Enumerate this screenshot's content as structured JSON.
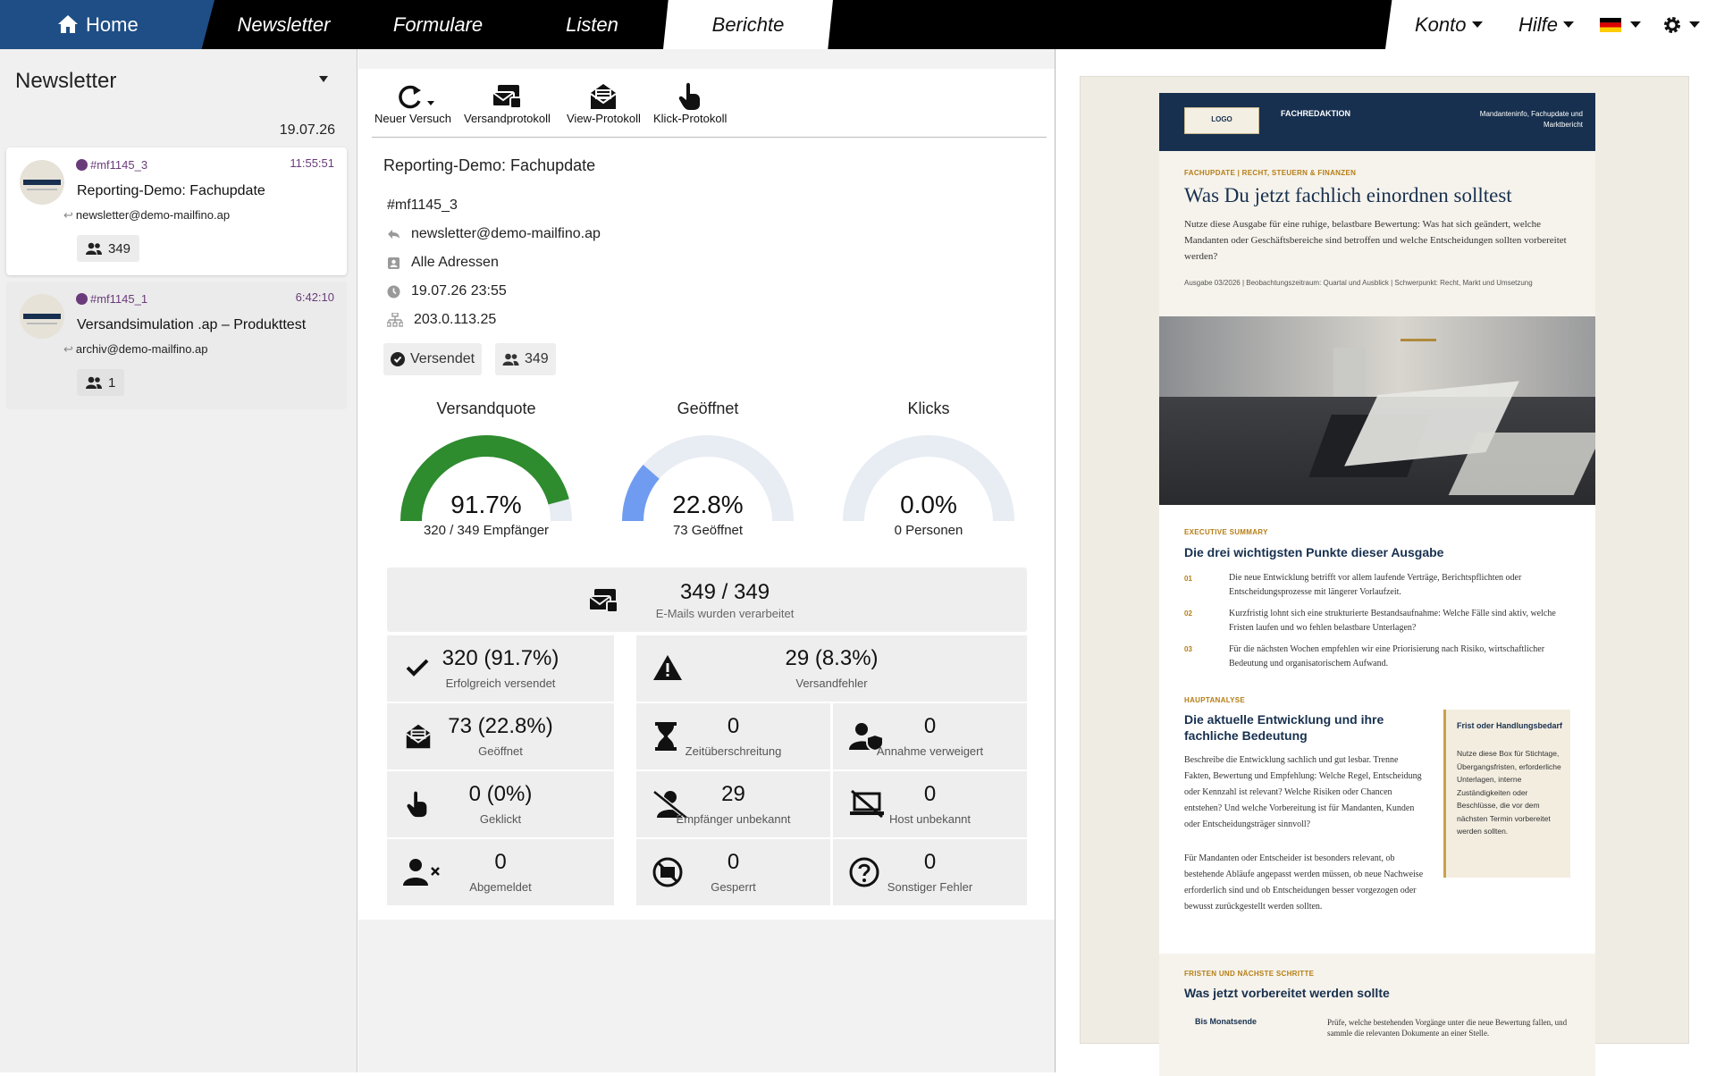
{
  "nav": {
    "home": "Home",
    "tabs": [
      "Newsletter",
      "Formulare",
      "Listen",
      "Berichte"
    ],
    "active_tab": "Berichte",
    "konto": "Konto",
    "hilfe": "Hilfe"
  },
  "sidebar": {
    "title": "Newsletter",
    "date": "19.07.26",
    "items": [
      {
        "id": "#mf1145_3",
        "time": "11:55:51",
        "name": "Reporting-Demo: Fachupdate",
        "from": "newsletter@demo-mailfino.ap",
        "count": "349"
      },
      {
        "id": "#mf1145_1",
        "time": "6:42:10",
        "name": "Versandsimulation .ap – Produkttest",
        "from": "archiv@demo-mailfino.ap",
        "count": "1"
      }
    ]
  },
  "toolbar": {
    "neuer_versuch": "Neuer Versuch",
    "versandprotokoll": "Versandprotokoll",
    "view_protokoll": "View-Protokoll",
    "klick_protokoll": "Klick-Protokoll"
  },
  "report": {
    "title": "Reporting-Demo: Fachupdate",
    "id": "#mf1145_3",
    "sender": "newsletter@demo-mailfino.ap",
    "recipients": "Alle Adressen",
    "datetime": "19.07.26 23:55",
    "ip": "203.0.113.25",
    "status": "Versendet",
    "count": "349"
  },
  "gauges": [
    {
      "label": "Versandquote",
      "value": "91.7%",
      "fraction": 0.917,
      "sub": "320 / 349 Empfänger",
      "color": "#2e8b2e"
    },
    {
      "label": "Geöffnet",
      "value": "22.8%",
      "fraction": 0.228,
      "sub": "73 Geöffnet",
      "color": "#6f9cf0"
    },
    {
      "label": "Klicks",
      "value": "0.0%",
      "fraction": 0.0,
      "sub": "0 Personen",
      "color": "#6f9cf0"
    }
  ],
  "stats": {
    "processed": {
      "value": "349 / 349",
      "label": "E-Mails wurden verarbeitet"
    },
    "success": {
      "value": "320 (91.7%)",
      "label": "Erfolgreich versendet"
    },
    "errors": {
      "value": "29 (8.3%)",
      "label": "Versandfehler"
    },
    "opened": {
      "value": "73 (22.8%)",
      "label": "Geöffnet"
    },
    "timeout": {
      "value": "0",
      "label": "Zeitüberschreitung"
    },
    "rejected": {
      "value": "0",
      "label": "Annahme verweigert"
    },
    "clicked": {
      "value": "0 (0%)",
      "label": "Geklickt"
    },
    "unknown_recipient": {
      "value": "29",
      "label": "Empfänger unbekannt"
    },
    "unknown_host": {
      "value": "0",
      "label": "Host unbekannt"
    },
    "unsubscribed": {
      "value": "0",
      "label": "Abgemeldet"
    },
    "blocked": {
      "value": "0",
      "label": "Gesperrt"
    },
    "other": {
      "value": "0",
      "label": "Sonstiger Fehler"
    }
  },
  "preview": {
    "logo": "LOGO",
    "brand": "FACHREDAKTION",
    "mandant": "Mandanteninfo, Fachupdate und Marktbericht",
    "kicker1": "FACHUPDATE | RECHT, STEUERN & FINANZEN",
    "headline": "Was Du jetzt fachlich einordnen solltest",
    "intro": "Nutze diese Ausgabe für eine ruhige, belastbare Bewertung: Was hat sich geändert, welche Mandanten oder Geschäftsbereiche sind betroffen und welche Entscheidungen sollten vorbereitet werden?",
    "meta": "Ausgabe 03/2026 | Beobachtungszeitraum: Quartal und Ausblick | Schwerpunkt: Recht, Markt und Umsetzung",
    "kicker2": "EXECUTIVE SUMMARY",
    "h2a": "Die drei wichtigsten Punkte dieser Ausgabe",
    "points": [
      {
        "n": "01",
        "t": "Die neue Entwicklung betrifft vor allem laufende Verträge, Berichtspflichten oder Entscheidungsprozesse mit längerer Vorlaufzeit."
      },
      {
        "n": "02",
        "t": "Kurzfristig lohnt sich eine strukturierte Bestandsaufnahme: Welche Fälle sind aktiv, welche Fristen laufen und wo fehlen belastbare Unterlagen?"
      },
      {
        "n": "03",
        "t": "Für die nächsten Wochen empfehlen wir eine Priorisierung nach Risiko, wirtschaftlicher Bedeutung und organisatorischem Aufwand."
      }
    ],
    "kicker3": "HAUPTANALYSE",
    "h2b": "Die aktuelle Entwicklung und ihre fachliche Bedeutung",
    "body1": "Beschreibe die Entwicklung sachlich und gut lesbar. Trenne Fakten, Bewertung und Empfehlung: Welche Regel, Entscheidung oder Kennzahl ist relevant? Welche Risiken oder Chancen entstehen? Und welche Vorbereitung ist für Mandanten, Kunden oder Entscheidungsträger sinnvoll?",
    "body2": "Für Mandanten oder Entscheider ist besonders relevant, ob bestehende Abläufe angepasst werden müssen, ob neue Nachweise erforderlich sind und ob Entscheidungen besser vorgezogen oder bewusst zurückgestellt werden sollten.",
    "box_title": "Frist oder Handlungsbedarf",
    "box_body": "Nutze diese Box für Stichtage, Übergangsfristen, erforderliche Unterlagen, interne Zuständigkeiten oder Beschlüsse, die vor dem nächsten Termin vorbereitet werden sollten.",
    "kicker4": "FRISTEN UND NÄCHSTE SCHRITTE",
    "h2c": "Was jetzt vorbereitet werden sollte",
    "row_label": "Bis Monatsende",
    "row_text": "Prüfe, welche bestehenden Vorgänge unter die neue Bewertung fallen, und sammle die relevanten Dokumente an einer Stelle."
  }
}
